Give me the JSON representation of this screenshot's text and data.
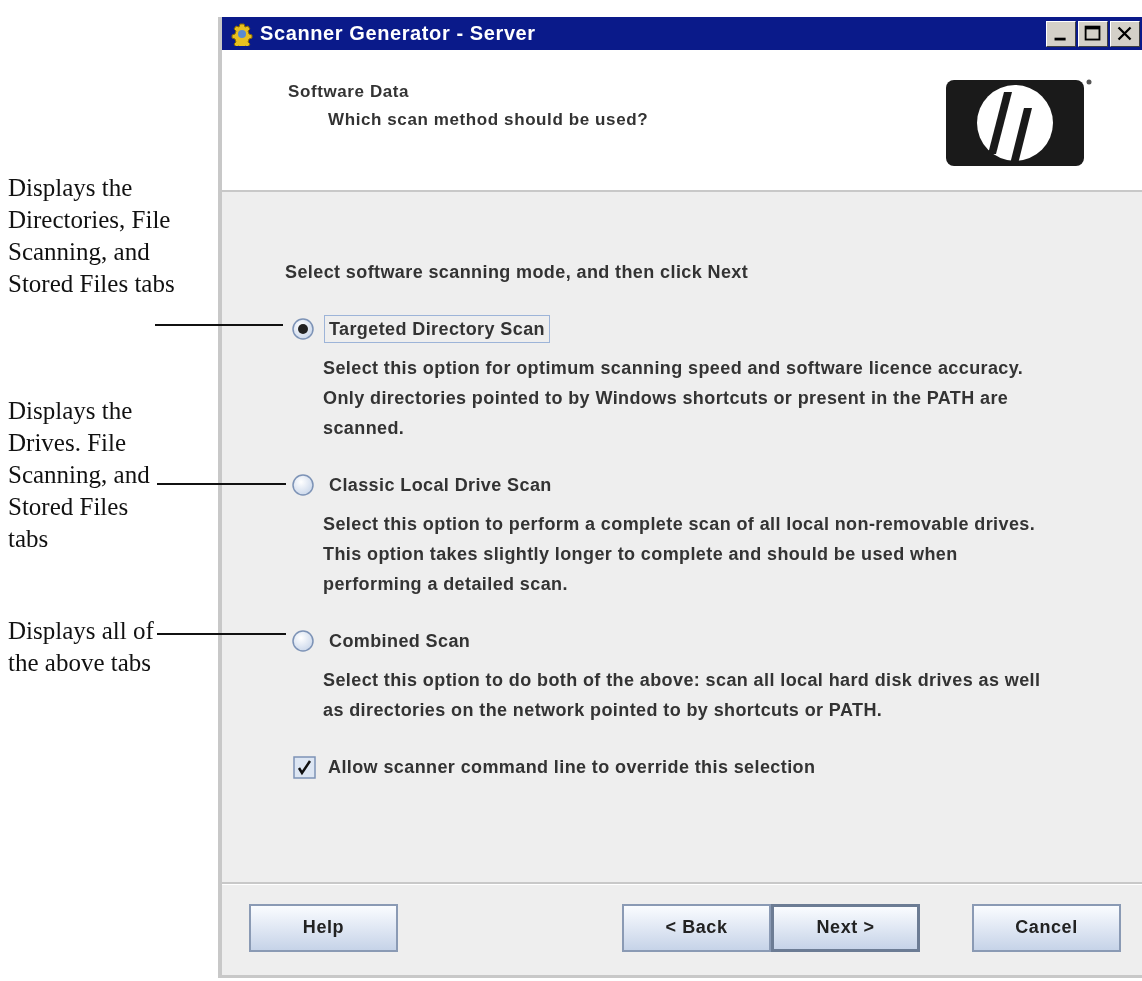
{
  "annotations": [
    {
      "text": "Displays the Directories, File Scanning, and Stored Files tabs"
    },
    {
      "text": "Displays the Drives. File Scanning, and Stored Files tabs"
    },
    {
      "text": "Displays all of the above tabs"
    }
  ],
  "window": {
    "title": "Scanner Generator - Server"
  },
  "header": {
    "title": "Software Data",
    "subtitle": "Which scan method should be used?"
  },
  "prompt": "Select software scanning mode, and then click Next",
  "options": [
    {
      "label": "Targeted Directory Scan",
      "selected": true,
      "focused": true,
      "description": "Select this option for optimum scanning speed and software licence accuracy.  Only directories pointed to by Windows shortcuts or present in the PATH are scanned."
    },
    {
      "label": "Classic Local Drive Scan",
      "selected": false,
      "focused": false,
      "description": "Select this option to perform a complete scan of all local non-removable drives.  This option takes slightly longer to complete and should be used when performing a detailed scan."
    },
    {
      "label": "Combined Scan",
      "selected": false,
      "focused": false,
      "description": "Select this option to do both of the above: scan all local hard disk drives as well as directories on the network pointed to by shortcuts or PATH."
    }
  ],
  "override": {
    "label": "Allow scanner command line to override this selection",
    "checked": true
  },
  "buttons": [
    {
      "label": "Help",
      "kind": "help",
      "default": false
    },
    {
      "label": "< Back",
      "kind": "nav",
      "default": false
    },
    {
      "label": "Next >",
      "kind": "nav",
      "default": true
    },
    {
      "label": "Cancel",
      "kind": "cancel",
      "default": false
    }
  ]
}
